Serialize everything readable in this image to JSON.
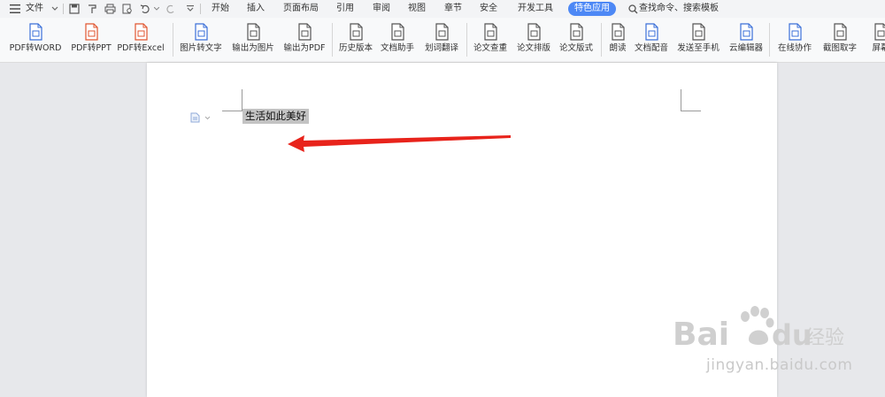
{
  "menubar": {
    "file_label": "文件",
    "tabs": [
      "开始",
      "插入",
      "页面布局",
      "引用",
      "审阅",
      "视图",
      "章节",
      "安全",
      "开发工具"
    ],
    "special_tab": "特色应用",
    "search_label": "查找命令、搜索模板"
  },
  "ribbon": {
    "tools": [
      {
        "label": "PDF转WORD",
        "icon": "pdf-to-word-icon",
        "color": "#3a6fd8"
      },
      {
        "label": "PDF转PPT",
        "icon": "pdf-to-ppt-icon",
        "color": "#e0552f"
      },
      {
        "label": "PDF转Excel",
        "icon": "pdf-to-excel-icon",
        "color": "#e0552f"
      },
      {
        "label": "图片转文字",
        "icon": "image-to-text-icon",
        "color": "#3a6fd8"
      },
      {
        "label": "输出为图片",
        "icon": "export-image-icon",
        "color": "#555555"
      },
      {
        "label": "输出为PDF",
        "icon": "export-pdf-icon",
        "color": "#555555"
      },
      {
        "label": "历史版本",
        "icon": "history-icon",
        "color": "#555555"
      },
      {
        "label": "文档助手",
        "icon": "doc-assistant-icon",
        "color": "#555555"
      },
      {
        "label": "划词翻译",
        "icon": "translate-icon",
        "color": "#555555"
      },
      {
        "label": "论文查重",
        "icon": "paper-check-icon",
        "color": "#555555"
      },
      {
        "label": "论文排版",
        "icon": "paper-layout-icon",
        "color": "#555555"
      },
      {
        "label": "论文版式",
        "icon": "paper-format-icon",
        "color": "#555555"
      },
      {
        "label": "朗读",
        "icon": "read-aloud-icon",
        "color": "#555555"
      },
      {
        "label": "文档配音",
        "icon": "dubbing-icon",
        "color": "#3a6fd8"
      },
      {
        "label": "发送至手机",
        "icon": "send-to-phone-icon",
        "color": "#555555"
      },
      {
        "label": "云编辑器",
        "icon": "cloud-editor-icon",
        "color": "#3a6fd8"
      },
      {
        "label": "在线协作",
        "icon": "online-collab-icon",
        "color": "#3a6fd8"
      },
      {
        "label": "截图取字",
        "icon": "screenshot-ocr-icon",
        "color": "#555555"
      },
      {
        "label": "屏幕",
        "icon": "screen-icon",
        "color": "#555555"
      }
    ]
  },
  "document": {
    "text": "生活如此美好"
  },
  "watermark": {
    "brand_a": "Bai",
    "brand_b": "du",
    "brand_cn": "经验",
    "url": "jingyan.baidu.com"
  },
  "colors": {
    "accent": "#4d88f5",
    "arrow": "#e8231b",
    "highlight": "#c3c3c3"
  }
}
